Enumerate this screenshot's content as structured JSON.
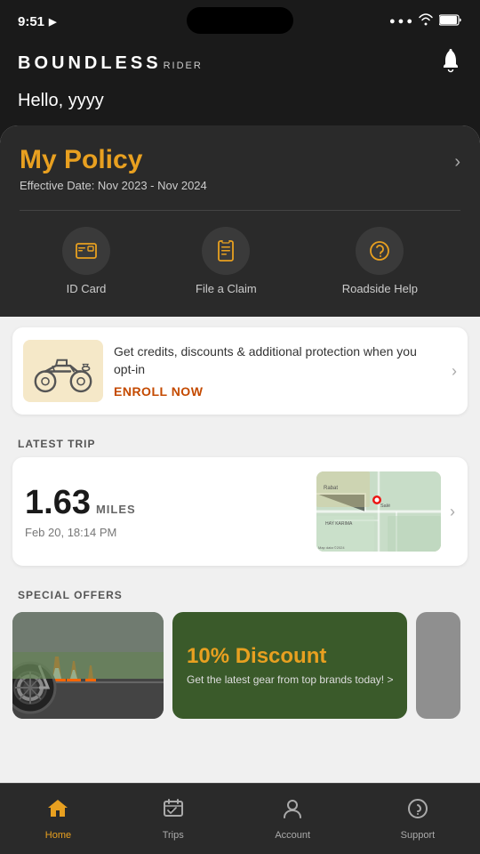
{
  "statusBar": {
    "time": "9:51",
    "locationArrow": "▶"
  },
  "header": {
    "logoMain": "BOUNDLESS",
    "logoSub": "RIDER",
    "greetingPrefix": "Hello, ",
    "greetingName": "yyyy"
  },
  "policy": {
    "title": "My Policy",
    "effectiveLabel": "Effective Date: Nov 2023  - Nov 2024",
    "actions": [
      {
        "label": "ID Card",
        "icon": "💳"
      },
      {
        "label": "File a Claim",
        "icon": "📋"
      },
      {
        "label": "Roadside Help",
        "icon": "📞"
      }
    ]
  },
  "enrollBanner": {
    "text": "Get credits, discounts & additional protection when you opt-in",
    "cta": "ENROLL NOW"
  },
  "latestTrip": {
    "sectionLabel": "LATEST TRIP",
    "miles": "1.63",
    "milesLabel": "MILES",
    "date": "Feb 20, 18:14 PM"
  },
  "specialOffers": {
    "sectionLabel": "SPECIAL OFFERS",
    "offers": [
      {
        "type": "bike-photo",
        "alt": "Motorcycle with cones"
      },
      {
        "type": "discount",
        "discount": "10% Discount",
        "desc": "Get the latest gear from top brands today! >"
      }
    ]
  },
  "bottomNav": [
    {
      "label": "Home",
      "icon": "home",
      "active": true
    },
    {
      "label": "Trips",
      "icon": "map",
      "active": false
    },
    {
      "label": "Account",
      "icon": "person",
      "active": false
    },
    {
      "label": "Support",
      "icon": "help",
      "active": false
    }
  ]
}
